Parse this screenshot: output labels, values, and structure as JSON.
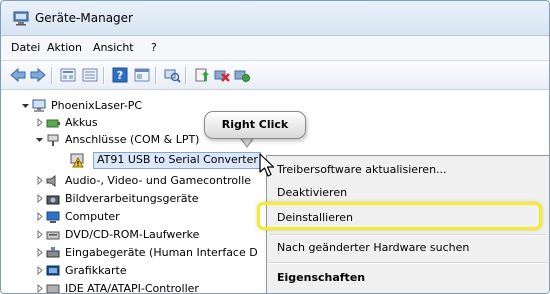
{
  "window": {
    "title": "Geräte-Manager",
    "title_icon": "device-manager-icon"
  },
  "menubar": {
    "items": [
      "Datei",
      "Aktion",
      "Ansicht",
      "?"
    ]
  },
  "toolbar": {
    "buttons": [
      "back-arrow-icon",
      "forward-arrow-icon",
      "properties-view-icon",
      "details-view-icon",
      "help-icon",
      "console-icon",
      "scan-hardware-icon",
      "update-driver-icon",
      "uninstall-icon",
      "enable-icon"
    ]
  },
  "tree": {
    "root": "PhoenixLaser-PC",
    "nodes": [
      {
        "label": "Akkus",
        "icon": "battery-icon"
      },
      {
        "label": "Anschlüsse (COM & LPT)",
        "icon": "port-icon"
      },
      {
        "label": "AT91 USB to Serial Converter",
        "icon": "warning-device-icon"
      },
      {
        "label": "Audio-, Video- und Gamecontrolle",
        "icon": "speaker-icon"
      },
      {
        "label": "Bildverarbeitungsgeräte",
        "icon": "camera-icon"
      },
      {
        "label": "Computer",
        "icon": "computer-icon"
      },
      {
        "label": "DVD/CD-ROM-Laufwerke",
        "icon": "dvd-icon"
      },
      {
        "label": "Eingabegeräte (Human Interface D",
        "icon": "hid-icon"
      },
      {
        "label": "Grafikkarte",
        "icon": "display-adapter-icon"
      },
      {
        "label": "IDE ATA/ATAPI-Controller",
        "icon": "ide-icon"
      }
    ]
  },
  "callout": {
    "text": "Right Click"
  },
  "context_menu": {
    "items": [
      "Treibersoftware aktualisieren...",
      "Deaktivieren",
      "Deinstallieren",
      "Nach geänderter Hardware suchen",
      "Eigenschaften"
    ]
  },
  "colors": {
    "highlight": "#f3ea3a",
    "selection": "#dbe8fb",
    "menu_bg": "#f0f0f0"
  }
}
